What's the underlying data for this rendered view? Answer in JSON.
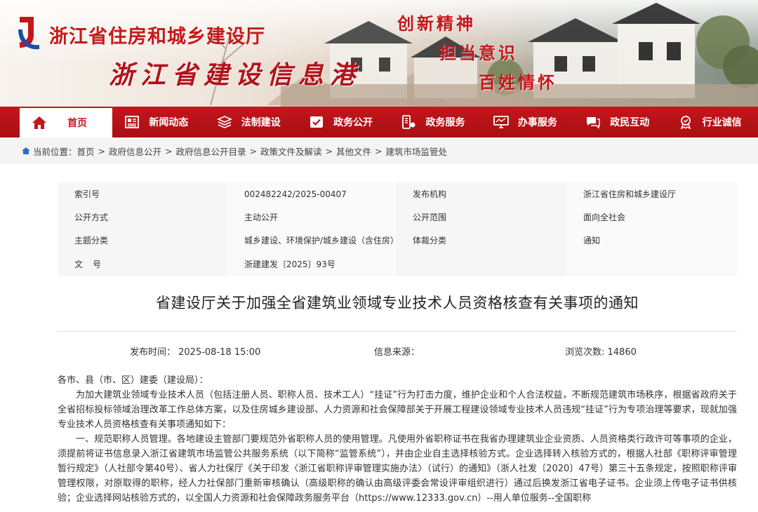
{
  "header": {
    "department": "浙江省住房和城乡建设厅",
    "portal": "浙江省建设信息港",
    "slogans": [
      "创新精神",
      "担当意识",
      "百姓情怀"
    ],
    "brand_color": "#c4161c"
  },
  "nav": {
    "items": [
      {
        "label": "首页",
        "icon": "home-icon"
      },
      {
        "label": "新闻动态",
        "icon": "newspaper-icon"
      },
      {
        "label": "法制建设",
        "icon": "layers-icon"
      },
      {
        "label": "政务公开",
        "icon": "check-document-icon"
      },
      {
        "label": "政务服务",
        "icon": "service-icon"
      },
      {
        "label": "办事服务",
        "icon": "monitor-icon"
      },
      {
        "label": "政民互动",
        "icon": "chat-icon"
      },
      {
        "label": "行业诚信",
        "icon": "badge-icon"
      }
    ],
    "active": "首页"
  },
  "breadcrumb": {
    "prefix": "当前位置：",
    "items": [
      "首页",
      "政府信息公开",
      "政府信息公开目录",
      "政策文件及解读",
      "其他文件",
      "建筑市场监管处"
    ]
  },
  "meta": {
    "index_label": "索引号",
    "index_value": "002482242/2025-00407",
    "issuer_label": "发布机构",
    "issuer_value": "浙江省住房和城乡建设厅",
    "mode_label": "公开方式",
    "mode_value": "主动公开",
    "scope_label": "公开范围",
    "scope_value": "面向全社会",
    "topic_label": "主题分类",
    "topic_value": "城乡建设、环境保护/城乡建设（含住房）",
    "genre_label": "体裁分类",
    "genre_value": "通知",
    "docno_label": "文号",
    "docno_value": "浙建建发〔2025〕93号"
  },
  "article": {
    "title": "省建设厅关于加强全省建筑业领域专业技术人员资格核查有关事项的通知",
    "publish_time": "发布时间：  2025-08-18 15:00",
    "source": "信息来源：",
    "views": "浏览次数: 14860",
    "salutation": "各市、县（市、区）建委（建设局）：",
    "para1": "为加大建筑业领域专业技术人员（包括注册人员、职称人员、技术工人）“挂证”行为打击力度，维护企业和个人合法权益，不断规范建筑市场秩序，根据省政府关于全省招标投标领域治理改革工作总体方案，以及住房城乡建设部、人力资源和社会保障部关于开展工程建设领域专业技术人员违规“挂证”行为专项治理等要求，现就加强专业技术人员资格核查有关事项通知如下：",
    "para2": "一、规范职称人员管理。各地建设主管部门要规范外省职称人员的使用管理。凡使用外省职称证书在我省办理建筑业企业资质、人员资格类行政许可等事项的企业，须提前将证书信息录入浙江省建筑市场监管公共服务系统（以下简称“监管系统”），并由企业自主选择核验方式。企业选择转入核验方式的，根据人社部《职称评审管理暂行规定》（人社部令第40号）、省人力社保厅《关于印发〈浙江省职称评审管理实施办法〉（试行）的通知》（浙人社发〔2020〕47号）第三十五条规定，按照职称评审管理权限，对原取得的职称，经人力社保部门重新审核确认（高级职称的确认由高级评委会常设评审组织进行）通过后换发浙江省电子证书。企业须上传电子证书供核验；企业选择网站核验方式的，以全国人力资源和社会保障政务服务平台（https://www.12333.gov.cn）--用人单位服务--全国职称"
  }
}
